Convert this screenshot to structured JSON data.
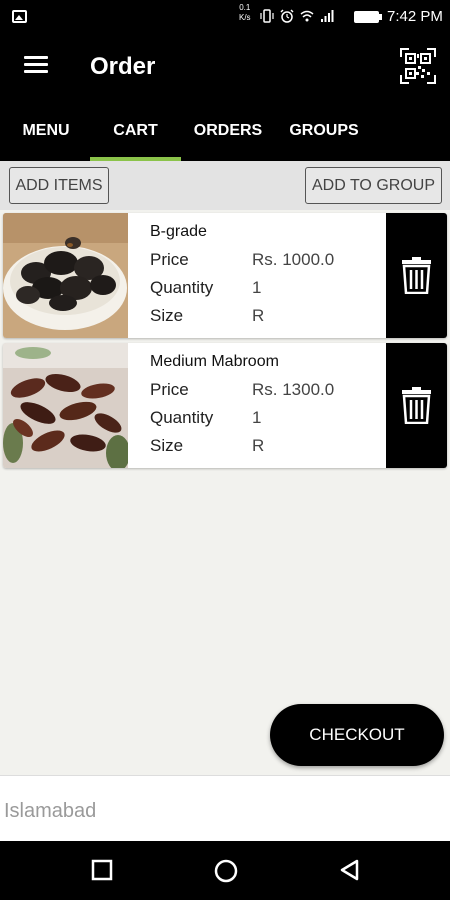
{
  "status_bar": {
    "speed_value": "0.1",
    "speed_unit": "K/s",
    "time": "7:42 PM"
  },
  "app_bar": {
    "title": "Order"
  },
  "tabs": [
    {
      "label": "MENU",
      "active": false
    },
    {
      "label": "CART",
      "active": true
    },
    {
      "label": "ORDERS",
      "active": false
    },
    {
      "label": "GROUPS",
      "active": false
    }
  ],
  "actions": {
    "add_items": "ADD ITEMS",
    "add_to_group": "ADD TO GROUP"
  },
  "cart_items": [
    {
      "name": "B-grade",
      "price_label": "Price",
      "price": "Rs. 1000.0",
      "quantity_label": "Quantity",
      "quantity": "1",
      "size_label": "Size",
      "size": "R",
      "image": "dark-dates-bowl-photo"
    },
    {
      "name": "Medium Mabroom",
      "price_label": "Price",
      "price": "Rs. 1300.0",
      "quantity_label": "Quantity",
      "quantity": "1",
      "size_label": "Size",
      "size": "R",
      "image": "mabroom-dates-photo"
    }
  ],
  "checkout_label": "CHECKOUT",
  "location": "Islamabad",
  "colors": {
    "accent": "#8bc34a",
    "bar": "#000000",
    "background": "#f2f2ee"
  },
  "icons": [
    "menu-icon",
    "qr-code-icon",
    "delete-icon",
    "back-icon",
    "home-icon",
    "recents-icon"
  ]
}
